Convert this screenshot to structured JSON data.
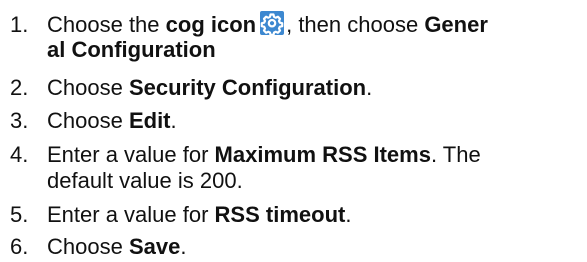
{
  "steps": [
    {
      "num": "1.",
      "p1": "Choose the ",
      "b1": "cog icon",
      "p2": ", then choose ",
      "b2a": "Gener",
      "b2b": "al Configuration",
      "icon": "cog-icon",
      "icon_color": "#3d88d0"
    },
    {
      "num": "2.",
      "p1": "Choose ",
      "b1": "Security Configuration",
      "p2": "."
    },
    {
      "num": "3.",
      "p1": "Choose ",
      "b1": "Edit",
      "p2": "."
    },
    {
      "num": "4.",
      "p1": "Enter a value for ",
      "b1": "Maximum RSS Items",
      "p2": ". The",
      "line2": "default value is 200."
    },
    {
      "num": "5.",
      "p1": "Enter a value for ",
      "b1": "RSS timeout",
      "p2": "."
    },
    {
      "num": "6.",
      "p1": "Choose ",
      "b1": "Save",
      "p2": "."
    }
  ]
}
